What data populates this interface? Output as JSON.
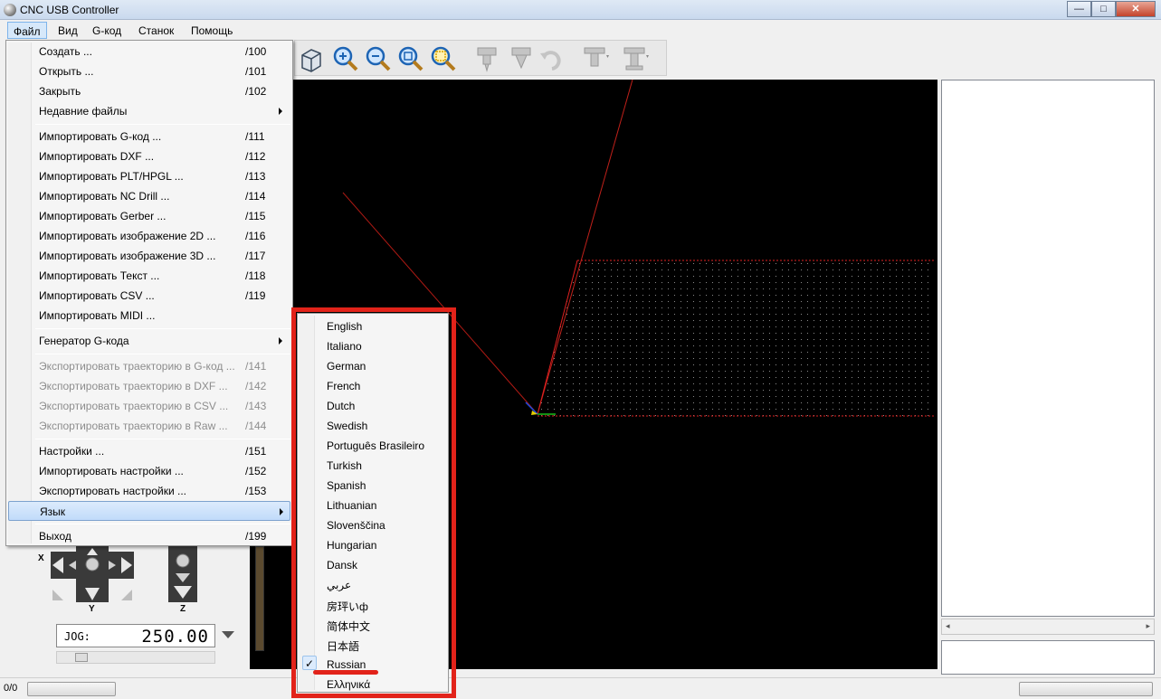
{
  "window": {
    "title": "CNC USB Controller",
    "min_symbol": "—",
    "max_symbol": "□",
    "close_symbol": "✕"
  },
  "menubar": {
    "items": [
      "Файл",
      "Вид",
      "G-код",
      "Станок",
      "Помощь"
    ]
  },
  "file_menu": {
    "items": [
      {
        "label": "Создать ...",
        "shortcut": "/100"
      },
      {
        "label": "Открыть ...",
        "shortcut": "/101"
      },
      {
        "label": "Закрыть",
        "shortcut": "/102"
      },
      {
        "label": "Недавние файлы",
        "shortcut": ""
      },
      {
        "label": "Импортировать G-код ...",
        "shortcut": "/111"
      },
      {
        "label": "Импортировать DXF ...",
        "shortcut": "/112"
      },
      {
        "label": "Импортировать PLT/HPGL ...",
        "shortcut": "/113"
      },
      {
        "label": "Импортировать NC Drill ...",
        "shortcut": "/114"
      },
      {
        "label": "Импортировать Gerber ...",
        "shortcut": "/115"
      },
      {
        "label": "Импортировать изображение 2D ...",
        "shortcut": "/116"
      },
      {
        "label": "Импортировать изображение 3D ...",
        "shortcut": "/117"
      },
      {
        "label": "Импортировать Текст ...",
        "shortcut": "/118"
      },
      {
        "label": "Импортировать CSV ...",
        "shortcut": "/119"
      },
      {
        "label": "Импортировать MIDI ...",
        "shortcut": ""
      },
      {
        "label": "Генератор G-кода",
        "shortcut": ""
      },
      {
        "label": "Экспортировать траекторию в G-код ...",
        "shortcut": "/141"
      },
      {
        "label": "Экспортировать траекторию в DXF ...",
        "shortcut": "/142"
      },
      {
        "label": "Экспортировать траекторию в CSV ...",
        "shortcut": "/143"
      },
      {
        "label": "Экспортировать траекторию в Raw ...",
        "shortcut": "/144"
      },
      {
        "label": "Настройки ...",
        "shortcut": "/151"
      },
      {
        "label": "Импортировать настройки ...",
        "shortcut": "/152"
      },
      {
        "label": "Экспортировать настройки ...",
        "shortcut": "/153"
      },
      {
        "label": "Язык",
        "shortcut": ""
      },
      {
        "label": "Выход",
        "shortcut": "/199"
      }
    ]
  },
  "language_menu": {
    "items": [
      "English",
      "Italiano",
      "German",
      "French",
      "Dutch",
      "Swedish",
      "Português Brasileiro",
      "Turkish",
      "Spanish",
      "Lithuanian",
      "Slovenščina",
      "Hungarian",
      "Dansk",
      "عربي",
      "房玶いф",
      "简体中文",
      "日本語",
      "Russian",
      "Ελληνικά"
    ],
    "selected": "Russian",
    "check_symbol": "✓"
  },
  "jog": {
    "label": "JOG:",
    "value": "250.00",
    "axis_x": "X",
    "axis_y": "Y",
    "axis_z": "Z"
  },
  "status": {
    "text": "0/0"
  },
  "colors": {
    "highlight_frame": "#e2231a",
    "viewport_bg": "#000000",
    "menu_highlight": "#c1dbfa"
  }
}
